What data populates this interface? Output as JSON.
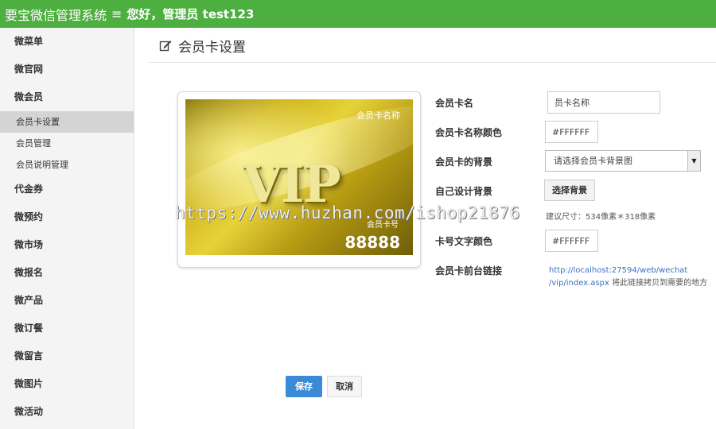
{
  "header": {
    "app_title": "要宝微信管理系统",
    "menu_icon": "≡",
    "greeting": "您好，管理员 test123"
  },
  "sidebar": {
    "items": [
      {
        "label": "微菜单"
      },
      {
        "label": "微官网"
      },
      {
        "label": "微会员"
      },
      {
        "label": "代金券"
      },
      {
        "label": "微预约"
      },
      {
        "label": "微市场"
      },
      {
        "label": "微报名"
      },
      {
        "label": "微产品"
      },
      {
        "label": "微订餐"
      },
      {
        "label": "微留言"
      },
      {
        "label": "微图片"
      },
      {
        "label": "微活动"
      }
    ],
    "sub_items": [
      {
        "label": "会员卡设置",
        "active": true
      },
      {
        "label": "会员管理"
      },
      {
        "label": "会员说明管理"
      }
    ]
  },
  "page": {
    "title": "会员卡设置"
  },
  "card": {
    "vip_text": "VIP",
    "name": "会员卡名称",
    "number_label": "会员卡号",
    "number": "88888"
  },
  "form": {
    "name_label": "会员卡名",
    "name_value": "员卡名称",
    "name_color_label": "会员卡名称颜色",
    "name_color_value": "#FFFFFF",
    "bg_label": "会员卡的背景",
    "bg_select": "请选择会员卡背景图",
    "custom_bg_label": "自己设计背景",
    "choose_bg_button": "选择背景",
    "size_hint": "建议尺寸：534像素＊318像素",
    "number_color_label": "卡号文字颜色",
    "number_color_value": "#FFFFFF",
    "link_label": "会员卡前台链接",
    "link_url_1": "http://localhost:27594/web/wechat",
    "link_url_2": "/vip/index.aspx",
    "link_note": " 将此链接拷贝到需要的地方"
  },
  "actions": {
    "save": "保存",
    "cancel": "取消"
  },
  "watermark": "https://www.huzhan.com/ishop21876",
  "colors": {
    "header_bg": "#4caf3f",
    "primary_button": "#3a8ad7",
    "link": "#3a70c0"
  }
}
